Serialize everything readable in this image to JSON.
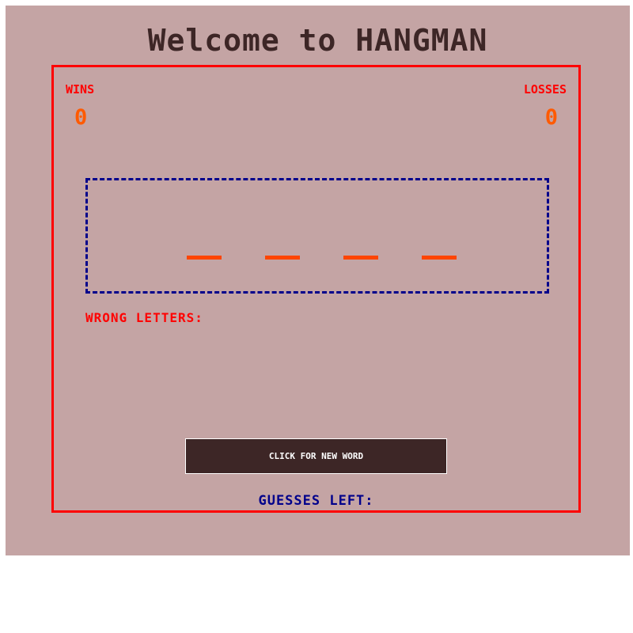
{
  "page": {
    "title": "Welcome to HANGMAN"
  },
  "scoreboard": {
    "wins_label": "WINS",
    "wins_value": "0",
    "losses_label": "LOSSES",
    "losses_value": "0"
  },
  "word": {
    "blanks": [
      "_",
      "_",
      "_",
      "_"
    ]
  },
  "wrong_letters": {
    "label": "WRONG LETTERS:"
  },
  "controls": {
    "new_word_label": "CLICK FOR NEW WORD"
  },
  "guesses": {
    "label": "GUESSES LEFT:"
  },
  "colors": {
    "background": "#c4a4a4",
    "title": "#3d2626",
    "border": "#ff0000",
    "score": "#ff5a00",
    "word_box_border": "#00008b",
    "blank": "#ff4500",
    "button_bg": "#3d2626",
    "guesses_text": "#00008b"
  }
}
